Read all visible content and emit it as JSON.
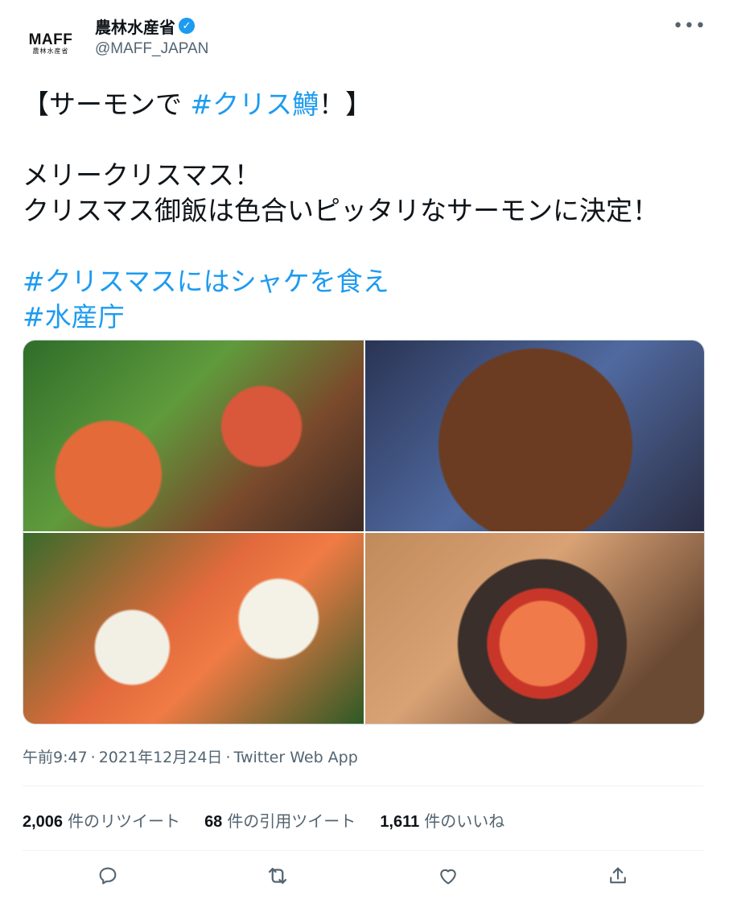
{
  "author": {
    "display_name": "農林水産省",
    "handle": "@MAFF_JAPAN",
    "logo_main": "MAFF",
    "logo_sub": "農林水産省"
  },
  "more_label": "•••",
  "tweet": {
    "line1_pre": "【サーモンで ",
    "line1_hashtag": "#クリス鱒",
    "line1_post": "！】",
    "line2": "メリークリスマス！",
    "line3": "クリスマス御飯は色合いピッタリなサーモンに決定！",
    "hashtag1": "#クリスマスにはシャケを食え",
    "hashtag2": "#水産庁"
  },
  "media": {
    "photos": [
      "salad-with-salmon-snowman-photo",
      "salmon-crackers-platter-photo",
      "salmon-snowman-closeup-photo",
      "salmon-ikura-rice-pot-photo"
    ]
  },
  "meta": {
    "time": "午前9:47",
    "date": "2021年12月24日",
    "app": "Twitter Web App",
    "separator": "·"
  },
  "stats": {
    "retweets_count": "2,006",
    "retweets_label": "件のリツイート",
    "quotes_count": "68",
    "quotes_label": "件の引用ツイート",
    "likes_count": "1,611",
    "likes_label": "件のいいね"
  },
  "colors": {
    "accent": "#1d9bf0",
    "text": "#0f1419",
    "muted": "#536471",
    "border": "#eff3f4"
  }
}
